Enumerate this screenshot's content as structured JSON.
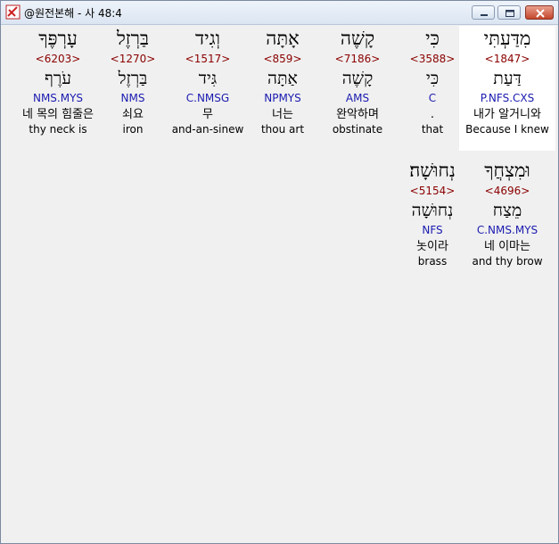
{
  "window": {
    "title": "@원전본해 - 사 48:4",
    "icon": "bible-app-icon"
  },
  "colors": {
    "strong": "#8b0000",
    "morph": "#1a1ab0",
    "selected_bg": "#ffffff"
  },
  "rows": [
    [
      {
        "hebrew": "מִדַּעְתִּי",
        "strong": "<1847>",
        "lemma": "דַּעַת",
        "morph": "P.NFS.CXS",
        "korean": "내가 알거니와",
        "english": "Because I knew",
        "selected": true
      },
      {
        "hebrew": "כִּי",
        "strong": "<3588>",
        "lemma": "כִּי",
        "morph": "C",
        "korean": ".",
        "english": "that"
      },
      {
        "hebrew": "קָשֶׁה",
        "strong": "<7186>",
        "lemma": "קָשֶׁה",
        "morph": "AMS",
        "korean": "완악하며",
        "english": "obstinate"
      },
      {
        "hebrew": "אָתָּה",
        "strong": "<859>",
        "lemma": "אַתָּה",
        "morph": "NPMYS",
        "korean": "너는",
        "english": "thou art"
      },
      {
        "hebrew": "וְגִיד",
        "strong": "<1517>",
        "lemma": "גִּיד",
        "morph": "C.NMSG",
        "korean": "무",
        "english": "and-an-sinew"
      },
      {
        "hebrew": "בַּרְזֶל",
        "strong": "<1270>",
        "lemma": "בַּרְזֶל",
        "morph": "NMS",
        "korean": "쇠요",
        "english": "iron"
      },
      {
        "hebrew": "עָרְפֶּךָ",
        "strong": "<6203>",
        "lemma": "עֹרֶף",
        "morph": "NMS.MYS",
        "korean": "네 목의 힘줄은",
        "english": "thy neck is"
      }
    ],
    [
      {
        "hebrew": "וּמִצְחֲךָ",
        "strong": "<4696>",
        "lemma": "מֵצַח",
        "morph": "C.NMS.MYS",
        "korean": "네 이마는",
        "english": "and thy brow"
      },
      {
        "hebrew": "נְחוּשָׁה׃",
        "strong": "<5154>",
        "lemma": "נְחוּשָׁה",
        "morph": "NFS",
        "korean": "놋이라",
        "english": "brass"
      }
    ]
  ]
}
